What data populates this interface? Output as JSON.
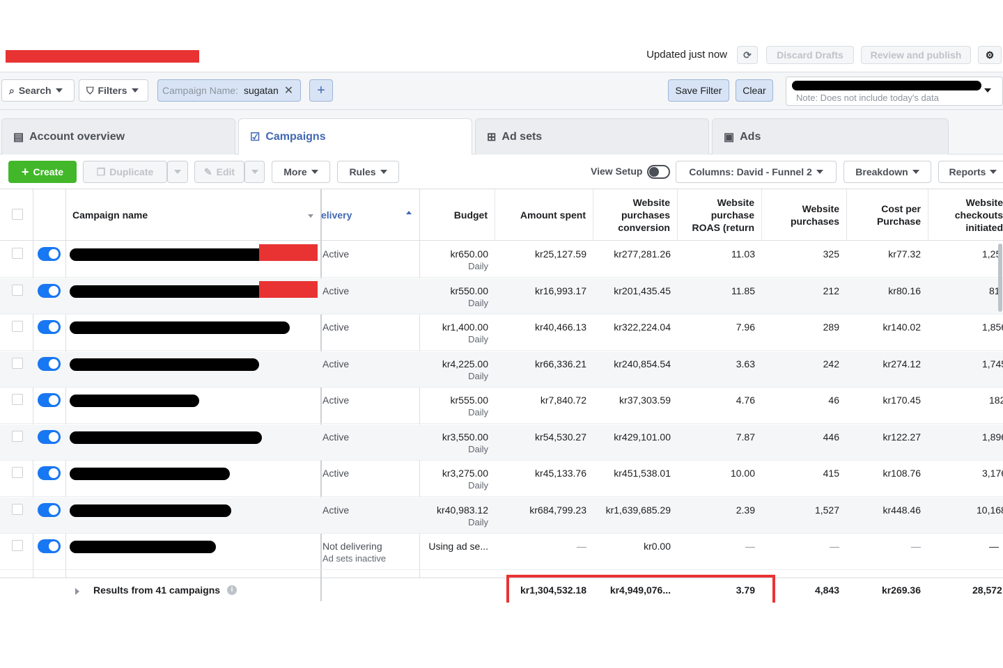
{
  "header": {
    "updated": "Updated just now",
    "discard": "Discard Drafts",
    "review": "Review and publish"
  },
  "filters": {
    "search": "Search",
    "filters": "Filters",
    "chip_key": "Campaign Name:",
    "chip_value": "sugatan",
    "save_filter": "Save Filter",
    "clear": "Clear",
    "date_note": "Note: Does not include today's data"
  },
  "tabs": [
    "Account overview",
    "Campaigns",
    "Ad sets",
    "Ads"
  ],
  "toolbar": {
    "create": "Create",
    "duplicate": "Duplicate",
    "edit": "Edit",
    "more": "More",
    "rules": "Rules",
    "view_setup": "View Setup",
    "columns": "Columns: David - Funnel 2",
    "breakdown": "Breakdown",
    "reports": "Reports"
  },
  "columns": {
    "name": "Campaign name",
    "delivery": "elivery",
    "budget": "Budget",
    "spent": "Amount spent",
    "conv": "Website purchases conversion",
    "roas": "Website purchase ROAS (return",
    "purchases": "Website purchases",
    "cpp": "Cost per Purchase",
    "checkouts": "Website checkouts initiated"
  },
  "rows": [
    {
      "delivery": "Active",
      "budget": "kr650.00",
      "budget_sub": "Daily",
      "spent": "kr25,127.59",
      "conv": "kr277,281.26",
      "roas": "11.03",
      "purchases": "325",
      "cpp": "kr77.32",
      "checkouts": "1,25"
    },
    {
      "delivery": "Active",
      "budget": "kr550.00",
      "budget_sub": "Daily",
      "spent": "kr16,993.17",
      "conv": "kr201,435.45",
      "roas": "11.85",
      "purchases": "212",
      "cpp": "kr80.16",
      "checkouts": "81"
    },
    {
      "delivery": "Active",
      "budget": "kr1,400.00",
      "budget_sub": "Daily",
      "spent": "kr40,466.13",
      "conv": "kr322,224.04",
      "roas": "7.96",
      "purchases": "289",
      "cpp": "kr140.02",
      "checkouts": "1,856"
    },
    {
      "delivery": "Active",
      "budget": "kr4,225.00",
      "budget_sub": "Daily",
      "spent": "kr66,336.21",
      "conv": "kr240,854.54",
      "roas": "3.63",
      "purchases": "242",
      "cpp": "kr274.12",
      "checkouts": "1,745"
    },
    {
      "delivery": "Active",
      "budget": "kr555.00",
      "budget_sub": "Daily",
      "spent": "kr7,840.72",
      "conv": "kr37,303.59",
      "roas": "4.76",
      "purchases": "46",
      "cpp": "kr170.45",
      "checkouts": "182"
    },
    {
      "delivery": "Active",
      "budget": "kr3,550.00",
      "budget_sub": "Daily",
      "spent": "kr54,530.27",
      "conv": "kr429,101.00",
      "roas": "7.87",
      "purchases": "446",
      "cpp": "kr122.27",
      "checkouts": "1,896"
    },
    {
      "delivery": "Active",
      "budget": "kr3,275.00",
      "budget_sub": "Daily",
      "spent": "kr45,133.76",
      "conv": "kr451,538.01",
      "roas": "10.00",
      "purchases": "415",
      "cpp": "kr108.76",
      "checkouts": "3,176"
    },
    {
      "delivery": "Active",
      "budget": "kr40,983.12",
      "budget_sub": "Daily",
      "spent": "kr684,799.23",
      "conv": "kr1,639,685.29",
      "roas": "2.39",
      "purchases": "1,527",
      "cpp": "kr448.46",
      "checkouts": "10,168"
    },
    {
      "delivery": "Not delivering",
      "delivery_sub": "Ad sets inactive",
      "budget": "Using ad se...",
      "budget_sub": "",
      "spent": "—",
      "conv": "kr0.00",
      "roas": "—",
      "purchases": "—",
      "cpp": "—",
      "checkouts": "—"
    }
  ],
  "totals": {
    "label": "Results from 41 campaigns",
    "spent": "kr1,304,532.18",
    "conv": "kr4,949,076...",
    "roas": "3.79",
    "purchases": "4,843",
    "cpp": "kr269.36",
    "checkouts": "28,572"
  },
  "colors": {
    "accent": "#4267b2",
    "toggle": "#1877f2",
    "create": "#42b72a",
    "redaction": "#e93333"
  }
}
